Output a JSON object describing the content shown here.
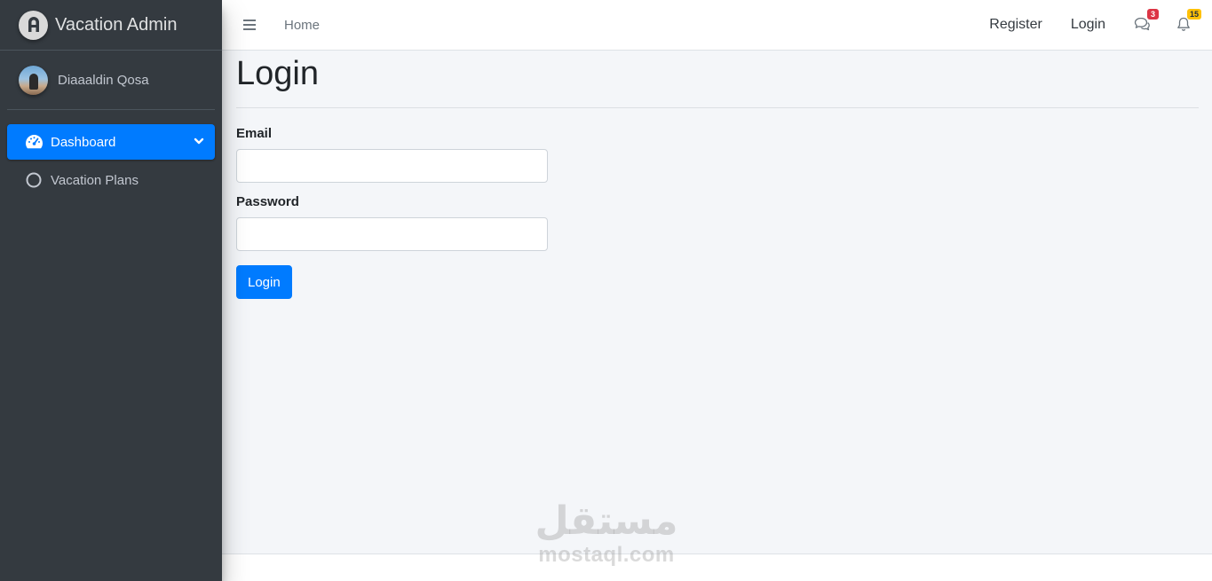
{
  "brand": {
    "title": "Vacation Admin",
    "logo_icon": "brand-logo-icon"
  },
  "user": {
    "name": "Diaaaldin Qosa"
  },
  "sidebar": {
    "items": [
      {
        "label": "Dashboard",
        "icon": "tachometer-icon",
        "active": true
      },
      {
        "label": "Vacation Plans",
        "icon": "circle-icon",
        "active": false
      }
    ]
  },
  "navbar": {
    "home_label": "Home",
    "register_label": "Register",
    "login_label": "Login",
    "messages_badge": "3",
    "notifications_badge": "15"
  },
  "page": {
    "title": "Login",
    "email_label": "Email",
    "email_value": "",
    "password_label": "Password",
    "password_value": "",
    "submit_label": "Login"
  },
  "watermark": {
    "arabic": "مستقل",
    "latin": "mostaql.com"
  },
  "colors": {
    "sidebar_bg": "#343a40",
    "primary": "#007bff",
    "content_bg": "#f4f6f9",
    "badge_danger": "#dc3545",
    "badge_warning": "#ffc107"
  }
}
